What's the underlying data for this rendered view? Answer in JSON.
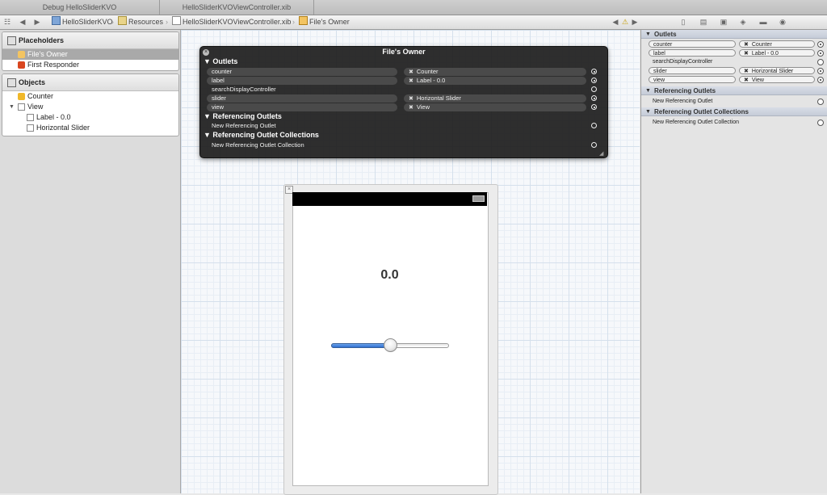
{
  "tabs": [
    "Debug HelloSliderKVO",
    "HelloSliderKVOViewController.xib"
  ],
  "jumpbar": {
    "crumbs": [
      "HelloSliderKVO",
      "Resources",
      "HelloSliderKVOViewController.xib",
      "File's Owner"
    ]
  },
  "outline": {
    "placeholders": {
      "title": "Placeholders",
      "items": [
        "File's Owner",
        "First Responder"
      ]
    },
    "objects": {
      "title": "Objects",
      "items": [
        "Counter",
        "View",
        "Label - 0.0",
        "Horizontal Slider"
      ]
    }
  },
  "hud": {
    "title": "File's Owner",
    "outlets_title": "Outlets",
    "outlets": [
      {
        "name": "counter",
        "target": "Counter"
      },
      {
        "name": "label",
        "target": "Label - 0.0"
      },
      {
        "name": "searchDisplayController",
        "target": ""
      },
      {
        "name": "slider",
        "target": "Horizontal Slider"
      },
      {
        "name": "view",
        "target": "View"
      }
    ],
    "ref_outlets_title": "Referencing Outlets",
    "new_ref_outlet": "New Referencing Outlet",
    "ref_collections_title": "Referencing Outlet Collections",
    "new_ref_collection": "New Referencing Outlet Collection"
  },
  "view": {
    "label_text": "0.0",
    "slider_value": 0.5
  },
  "inspector": {
    "outlets_title": "Outlets",
    "ref_outlets_title": "Referencing Outlets",
    "new_ref_outlet": "New Referencing Outlet",
    "ref_collections_title": "Referencing Outlet Collections",
    "new_ref_collection": "New Referencing Outlet Collection"
  },
  "colors": {
    "selection": "#5b8fd6",
    "slider_fill": "#2f6fd1",
    "hud_bg": "#1e1e1e"
  }
}
